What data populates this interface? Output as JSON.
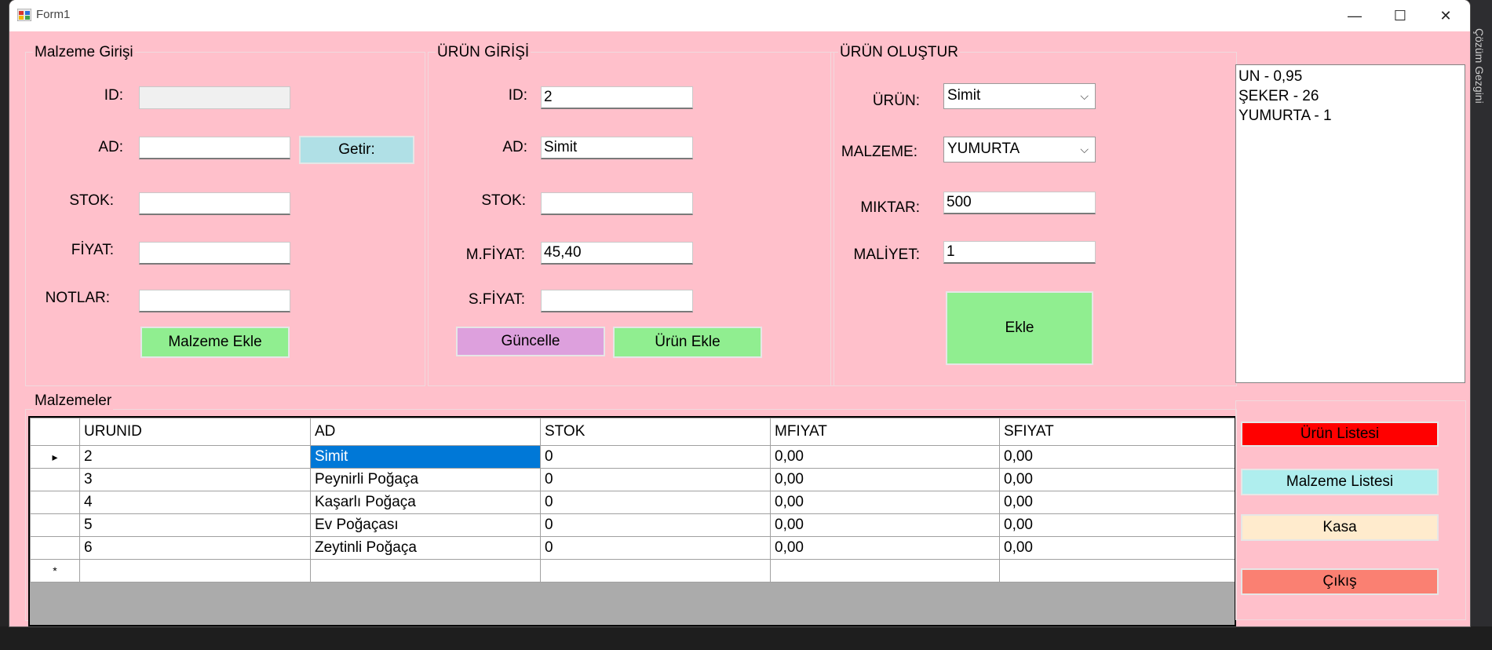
{
  "window": {
    "title": "Form1",
    "minimize": "—",
    "maximize": "☐",
    "close": "✕"
  },
  "ide": {
    "side_label": "Çözüm Gezgini"
  },
  "malzeme_girisi": {
    "title": "Malzeme Girişi",
    "id_label": "ID:",
    "id_value": "",
    "ad_label": "AD:",
    "ad_value": "",
    "getir_button": "Getir:",
    "stok_label": "STOK:",
    "stok_value": "",
    "fiyat_label": "FİYAT:",
    "fiyat_value": "",
    "notlar_label": "NOTLAR:",
    "notlar_value": "",
    "ekle_button": "Malzeme Ekle"
  },
  "urun_girisi": {
    "title": "ÜRÜN GİRİŞİ",
    "id_label": "ID:",
    "id_value": "2",
    "ad_label": "AD:",
    "ad_value": "Simit",
    "stok_label": "STOK:",
    "stok_value": "",
    "mfiyat_label": "M.FİYAT:",
    "mfiyat_value": "45,40",
    "sfiyat_label": "S.FİYAT:",
    "sfiyat_value": "",
    "guncelle_button": "Güncelle",
    "ekle_button": "Ürün Ekle"
  },
  "urun_olustur": {
    "title": "ÜRÜN OLUŞTUR",
    "urun_label": "ÜRÜN:",
    "urun_value": "Simit",
    "malzeme_label": "MALZEME:",
    "malzeme_value": "YUMURTA",
    "miktar_label": "MIKTAR:",
    "miktar_value": "500",
    "maliyet_label": "MALİYET:",
    "maliyet_value": "1",
    "ekle_button": "Ekle"
  },
  "recipe_list": [
    "UN - 0,95",
    "ŞEKER - 26",
    "YUMURTA - 1"
  ],
  "malzemeler": {
    "title": "Malzemeler",
    "columns": [
      "URUNID",
      "AD",
      "STOK",
      "MFIYAT",
      "SFIYAT"
    ],
    "rows": [
      [
        "2",
        "Simit",
        "0",
        "0,00",
        "0,00"
      ],
      [
        "3",
        "Peynirli Poğaça",
        "0",
        "0,00",
        "0,00"
      ],
      [
        "4",
        "Kaşarlı Poğaça",
        "0",
        "0,00",
        "0,00"
      ],
      [
        "5",
        "Ev Poğaçası",
        "0",
        "0,00",
        "0,00"
      ],
      [
        "6",
        "Zeytinli Poğaça",
        "0",
        "0,00",
        "0,00"
      ]
    ],
    "current_row_marker": "▸",
    "new_row_marker": "*"
  },
  "side_buttons": {
    "urun_listesi": "Ürün Listesi",
    "malzeme_listesi": "Malzeme Listesi",
    "kasa": "Kasa",
    "cikis": "Çıkış"
  },
  "colors": {
    "form_bg": "#ffc0cb",
    "green_button": "#90ee90",
    "getir_button": "#b0e0e6",
    "guncelle_button": "#dda0dd",
    "urun_listesi": "#ff0000",
    "malzeme_listesi": "#afeeee",
    "kasa": "#ffebcd",
    "cikis": "#fa8072",
    "selection": "#0078d7"
  }
}
